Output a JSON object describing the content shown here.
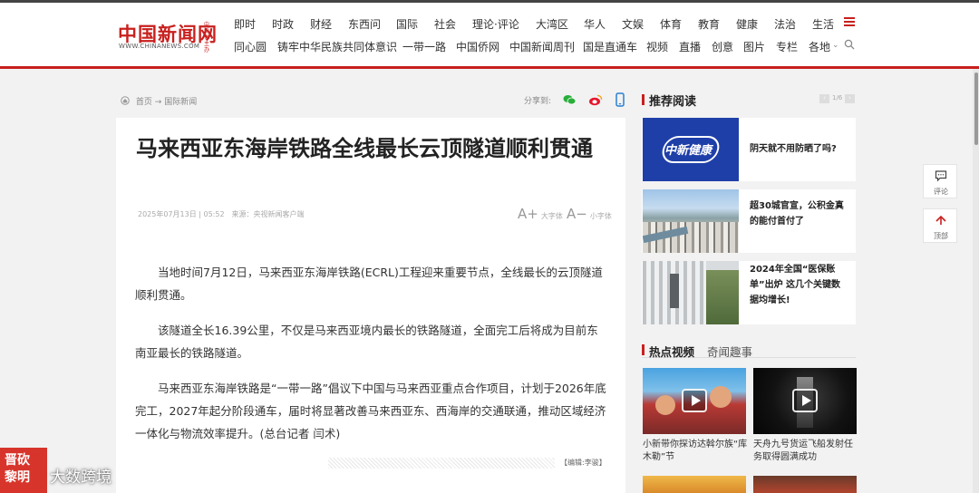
{
  "header": {
    "logo_cn": "中国新闻网",
    "logo_side": "中新社主办",
    "logo_en": "WWW.CHINANEWS.COM",
    "nav_row1": [
      "即时",
      "时政",
      "财经",
      "东西问",
      "国际",
      "社会",
      "理论·评论",
      "大湾区",
      "华人",
      "文娱",
      "体育",
      "教育",
      "健康",
      "法治",
      "生活"
    ],
    "nav_row2": [
      "同心圆",
      "铸牢中华民族共同体意识",
      "一带一路",
      "中国侨网",
      "中国新闻周刊",
      "国是直通车",
      "视频",
      "直播",
      "创意",
      "图片",
      "专栏",
      "各地"
    ]
  },
  "breadcrumb": {
    "home": "首页",
    "arrow": "→",
    "section": "国际新闻"
  },
  "share": {
    "label": "分享到:",
    "icons": [
      "wechat-icon",
      "weibo-icon",
      "mobile-icon"
    ]
  },
  "article": {
    "title": "马来西亚东海岸铁路全线最长云顶隧道顺利贯通",
    "meta": "2025年07月13日 | 05:52　来源：央视新闻客户端",
    "font_large": "大字体",
    "font_small": "小字体",
    "paragraphs": [
      "当地时间7月12日，马来西亚东海岸铁路(ECRL)工程迎来重要节点，全线最长的云顶隧道顺利贯通。",
      "该隧道全长16.39公里，不仅是马来西亚境内最长的铁路隧道，全面完工后将成为目前东南亚最长的铁路隧道。",
      "马来西亚东海岸铁路是“一带一路”倡议下中国与马来西亚重点合作项目，计划于2026年底完工，2027年起分阶段通车，届时将显著改善马来西亚东、西海岸的交通联通，推动区域经济一体化与物流效率提升。(总台记者 闫术)"
    ],
    "editor": "【编辑:李骏】"
  },
  "sidebar": {
    "recommend_title": "推荐阅读",
    "pager": "1/6",
    "items": [
      {
        "text": "阴天就不用防晒了吗?",
        "image_text": "中新健康"
      },
      {
        "text": "超30城官宣，公积金真的能付首付了"
      },
      {
        "text": "2024年全国“医保账单”出炉 这几个关键数据均增长!"
      }
    ],
    "hot_tab1": "热点视频",
    "hot_tab2": "奇闻趣事",
    "videos": [
      {
        "caption": "小新带你探访达斡尔族“库木勒”节"
      },
      {
        "caption": "天舟九号货运飞船发射任务取得圆满成功"
      }
    ]
  },
  "float": {
    "comment": "评论",
    "top": "顶部"
  },
  "watermark": {
    "logo_line1": "晋砍",
    "logo_line2": "黎明",
    "text": "大数跨境"
  },
  "colors": {
    "brand_red": "#c8201e",
    "background": "#f2f2f2"
  }
}
